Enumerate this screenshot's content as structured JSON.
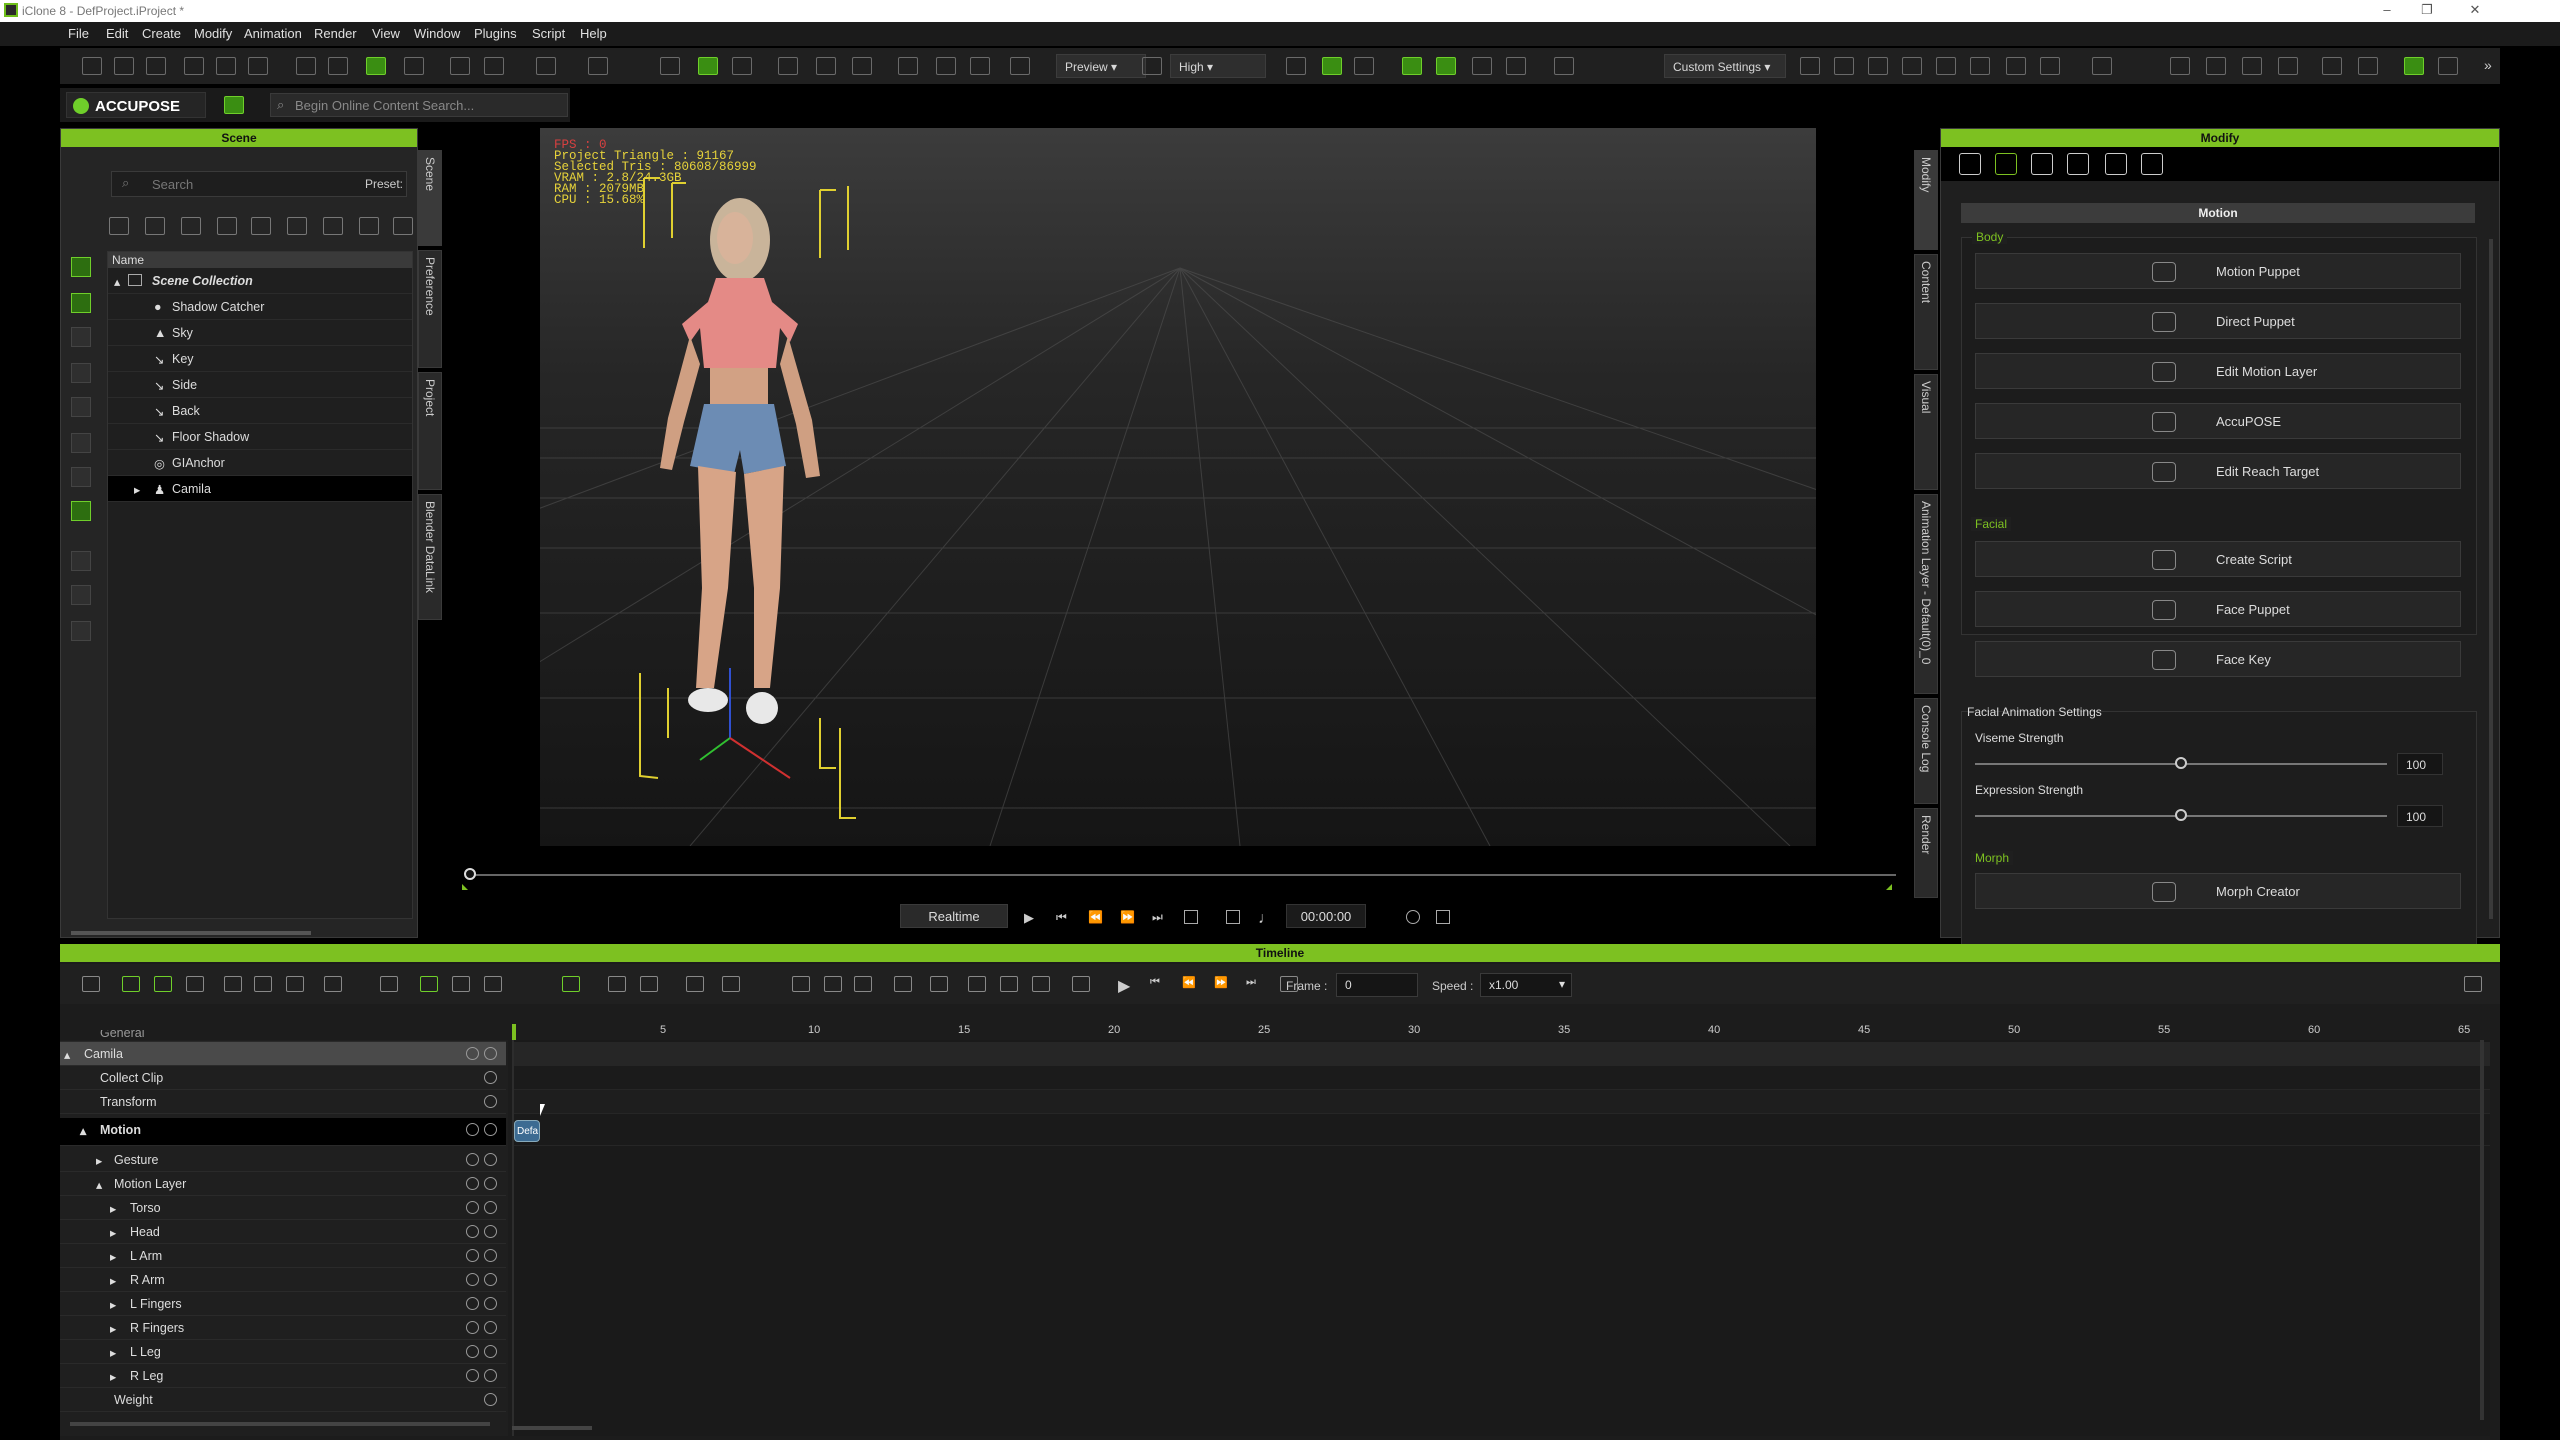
{
  "window": {
    "title": "iClone 8 - DefProject.iProject *"
  },
  "menu": [
    "File",
    "Edit",
    "Create",
    "Modify",
    "Animation",
    "Render",
    "View",
    "Window",
    "Plugins",
    "Script",
    "Help"
  ],
  "toolbar": {
    "preview": "Preview",
    "quality": "High",
    "settings": "Custom Settings"
  },
  "accu": {
    "label": "ACCUPOSE",
    "search_placeholder": "Begin Online Content Search..."
  },
  "scene": {
    "title": "Scene",
    "search_placeholder": "Search",
    "preset_label": "Preset:",
    "column": "Name",
    "items": [
      "Scene Collection",
      "Shadow Catcher",
      "Sky",
      "Key",
      "Side",
      "Back",
      "Floor Shadow",
      "GIAnchor",
      "Camila"
    ],
    "vtabs": [
      "Scene",
      "Preference",
      "Project",
      "Blender DataLink"
    ]
  },
  "viewport": {
    "stats": [
      "FPS : 0",
      "Project Triangle : 91167",
      "Selected Tris : 80608/86999",
      "VRAM : 2.8/24.3GB",
      "RAM : 2079MB",
      "CPU : 15.68%"
    ]
  },
  "playback": {
    "mode": "Realtime",
    "timecode": "00:00:00"
  },
  "modify": {
    "title": "Modify",
    "section": "Motion",
    "body_label": "Body",
    "body_buttons": [
      "Motion Puppet",
      "Direct Puppet",
      "Edit Motion Layer",
      "AccuPOSE",
      "Edit Reach Target"
    ],
    "facial_label": "Facial",
    "facial_buttons": [
      "Create Script",
      "Face Puppet",
      "Face Key"
    ],
    "fas_label": "Facial Animation Settings",
    "viseme_label": "Viseme Strength",
    "viseme_value": "100",
    "expression_label": "Expression Strength",
    "expression_value": "100",
    "viseme_level": 0.5,
    "expression_level": 0.5,
    "morph_label": "Morph",
    "morph_button": "Morph Creator",
    "vtabs": [
      "Modify",
      "Content",
      "Visual",
      "Animation Layer - Default(0)_0",
      "Console Log",
      "Render"
    ]
  },
  "timeline": {
    "title": "Timeline",
    "frame_label": "Frame :",
    "frame_value": "0",
    "speed_label": "Speed :",
    "speed_value": "x1.00",
    "ruler": [
      "5",
      "10",
      "15",
      "20",
      "25",
      "30",
      "35",
      "40",
      "45",
      "50",
      "55",
      "60",
      "65"
    ],
    "tracks": [
      "General",
      "Camila",
      "Collect Clip",
      "Transform",
      "Motion",
      "Gesture",
      "Motion Layer",
      "Torso",
      "Head",
      "L Arm",
      "R Arm",
      "L Fingers",
      "R Fingers",
      "L Leg",
      "R Leg",
      "Weight"
    ],
    "clip_label": "Defa"
  }
}
